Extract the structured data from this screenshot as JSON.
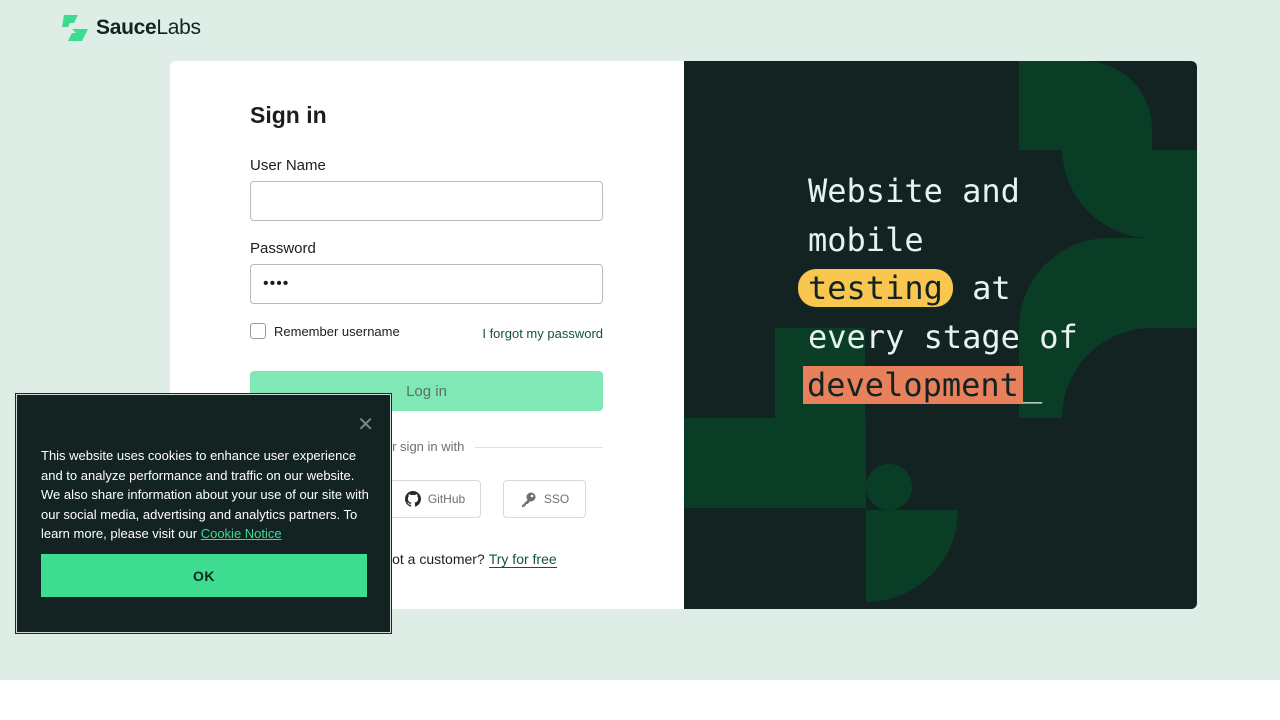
{
  "brand": {
    "name_bold": "Sauce",
    "name_light": "Labs"
  },
  "signin": {
    "title": "Sign in",
    "username_label": "User Name",
    "username_value": "",
    "password_label": "Password",
    "password_value": "••••",
    "remember_label": "Remember username",
    "forgot_link": "I forgot my password",
    "login_button": "Log in",
    "divider_text": "Or sign in with",
    "providers": [
      {
        "label": "GitHub",
        "icon": "github-icon"
      },
      {
        "label": "SSO",
        "icon": "key-icon"
      }
    ],
    "new_customer_text": "Not a customer?",
    "try_link": "Try for free"
  },
  "hero": {
    "line1": "Website and",
    "line2": "mobile",
    "line3_highlight": "testing",
    "line3_rest": " at",
    "line4": "every stage of",
    "line5_highlight": "development",
    "cursor": "_",
    "colors": {
      "yellow": "#f9c74f",
      "orange": "#e8805b",
      "bg": "#132322",
      "shape": "#0a3d26"
    }
  },
  "cookie_banner": {
    "text": "This website uses cookies to enhance user experience and to analyze performance and traffic on our website. We also share information about your use of our site with our social media, advertising and analytics partners. To learn more, please visit our",
    "link_text": "Cookie Notice",
    "ok_button": "OK",
    "close_icon": "close-icon"
  },
  "colors": {
    "accent": "#3ddc91",
    "page_bg": "#deede6",
    "link": "#13523f"
  }
}
